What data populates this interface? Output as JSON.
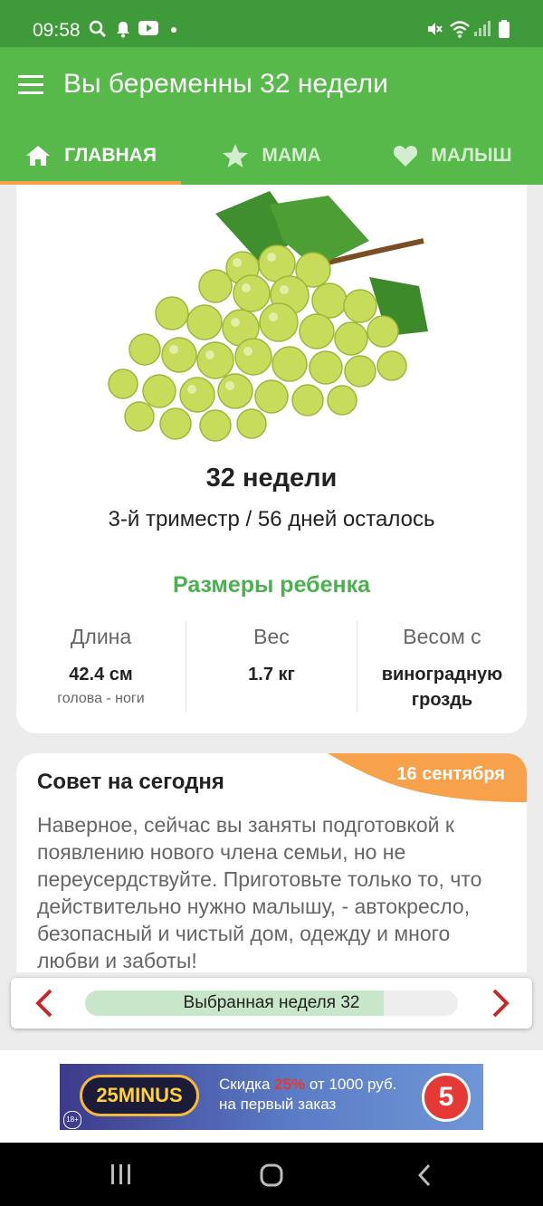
{
  "status_bar": {
    "time": "09:58",
    "left_icons": [
      "search-icon",
      "bell-icon",
      "youtube-icon",
      "dot-icon"
    ],
    "right_icons": [
      "mute-icon",
      "wifi-icon",
      "signal-icon",
      "battery-icon"
    ]
  },
  "app_bar": {
    "title": "Вы беременны 32 недели",
    "menu_icon": "hamburger-icon",
    "background": "#56b94a"
  },
  "tabs": [
    {
      "label": "ГЛАВНАЯ",
      "icon": "home-icon",
      "active": true
    },
    {
      "label": "МАМА",
      "icon": "star-icon",
      "active": false
    },
    {
      "label": "МАЛЫШ",
      "icon": "heart-icon",
      "active": false
    }
  ],
  "week_card": {
    "image": "grapes-image",
    "week_title": "32 недели",
    "trimester_line": "3-й триместр / 56 дней осталось",
    "sizes_heading": "Размеры ребенка",
    "length": {
      "label": "Длина",
      "value": "42.4 см",
      "sub": "голова - ноги"
    },
    "weight": {
      "label": "Вес",
      "value": "1.7 кг"
    },
    "compare": {
      "label": "Весом с",
      "value_line1": "виноградную",
      "value_line2": "гроздь"
    }
  },
  "tip_card": {
    "title": "Совет на сегодня",
    "date": "16 сентября",
    "text": "Наверное, сейчас вы заняты подготовкой к появлению нового члена семьи, но не переусердствуйте. Приготовьте только то, что действительно нужно малышу, - автокресло, безопасный и чистый дом, одежду и много любви и заботы!"
  },
  "week_nav": {
    "label": "Выбранная неделя 32",
    "progress": 0.8,
    "prev_icon": "chevron-left-icon",
    "next_icon": "chevron-right-icon"
  },
  "ad": {
    "logo": "25MINUS",
    "line1_pre": "Скидка ",
    "discount": "25%",
    "line1_post": " от 1000 руб.",
    "line2": "на первый заказ",
    "age": "18+",
    "brand_digit": "5"
  },
  "colors": {
    "primary": "#56b94a",
    "status": "#3f9b3a",
    "accent": "#f7a24a",
    "green_text": "#4caf50",
    "red_arrow": "#c62828"
  }
}
